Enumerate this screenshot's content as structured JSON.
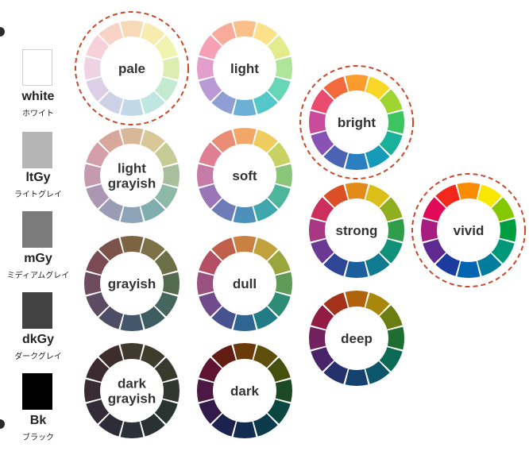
{
  "tones": [
    {
      "id": "pale",
      "label": [
        "pale"
      ],
      "highlighted": true,
      "colors": [
        "#f7d9b5",
        "#f7ebb0",
        "#f1f3b0",
        "#dcedb2",
        "#c4ebd1",
        "#c0e6e3",
        "#c1d8e9",
        "#cdd2e6",
        "#dccfe6",
        "#efd2e4",
        "#f6d1db",
        "#f7d3c8"
      ]
    },
    {
      "id": "light",
      "label": [
        "light"
      ],
      "highlighted": false,
      "colors": [
        "#fbbf8a",
        "#fbe28a",
        "#e2ec8a",
        "#aee59a",
        "#67d6b6",
        "#54c7c8",
        "#6bb0d4",
        "#8f9fd4",
        "#b99ad6",
        "#e39fcb",
        "#f6a0b5",
        "#f8ab98"
      ]
    },
    {
      "id": "bright",
      "label": [
        "bright"
      ],
      "highlighted": true,
      "colors": [
        "#fb9b2d",
        "#f7d626",
        "#9fd432",
        "#3cc460",
        "#1ab19a",
        "#159bba",
        "#2a7fc1",
        "#4b63b5",
        "#8851b4",
        "#c94b9c",
        "#e94a6e",
        "#f26a3c"
      ]
    },
    {
      "id": "vivid",
      "label": [
        "vivid"
      ],
      "highlighted": true,
      "colors": [
        "#fb8c00",
        "#f8e700",
        "#86c800",
        "#009e40",
        "#009878",
        "#007c9c",
        "#0064b0",
        "#1b3c9e",
        "#5e2a90",
        "#a81d80",
        "#e10a58",
        "#f2281c"
      ]
    },
    {
      "id": "ltgy",
      "label": [
        "light",
        "grayish"
      ],
      "highlighted": false,
      "colors": [
        "#d8b898",
        "#d8c898",
        "#c6cc98",
        "#a7bf9c",
        "#8cb9a8",
        "#80aeae",
        "#8da4b8",
        "#9a9cb6",
        "#ab97b4",
        "#c49aaf",
        "#d49fa9",
        "#d8a79c"
      ]
    },
    {
      "id": "soft",
      "label": [
        "soft"
      ],
      "highlighted": false,
      "colors": [
        "#f3a766",
        "#efcc5e",
        "#c8d161",
        "#8bc57a",
        "#4cb59c",
        "#3ea6ad",
        "#4c8fba",
        "#6e7db8",
        "#9a76b6",
        "#c67aa6",
        "#e07e92",
        "#e98d74"
      ]
    },
    {
      "id": "strong",
      "label": [
        "strong"
      ],
      "highlighted": false,
      "colors": [
        "#e28a1a",
        "#dcbe18",
        "#8fae20",
        "#2f9c4a",
        "#12917a",
        "#117a93",
        "#1b5f9c",
        "#2f4596",
        "#6c3992",
        "#a83784",
        "#cc2f5a",
        "#db4e26"
      ]
    },
    {
      "id": "grayish",
      "label": [
        "grayish"
      ],
      "highlighted": false,
      "colors": [
        "#7b6344",
        "#7c7146",
        "#6b7046",
        "#546a4e",
        "#44665c",
        "#3d5e60",
        "#44566a",
        "#4f4d66",
        "#5d4a63",
        "#6f4b5f",
        "#7a4b55",
        "#7c5249"
      ]
    },
    {
      "id": "dull",
      "label": [
        "dull"
      ],
      "highlighted": false,
      "colors": [
        "#c98040",
        "#c1a13c",
        "#99a63e",
        "#5f9a58",
        "#2d8c76",
        "#227c86",
        "#2e6592",
        "#47538e",
        "#704b8c",
        "#995180",
        "#b44f64",
        "#c0604a"
      ]
    },
    {
      "id": "deep",
      "label": [
        "deep"
      ],
      "highlighted": false,
      "colors": [
        "#b0620a",
        "#a8880a",
        "#6c7e12",
        "#1e6e32",
        "#0c6a56",
        "#0b5668",
        "#14416e",
        "#24316a",
        "#482568",
        "#73215e",
        "#921c44",
        "#a4321a"
      ]
    },
    {
      "id": "dkgy",
      "label": [
        "dark",
        "grayish"
      ],
      "highlighted": false,
      "colors": [
        "#40392d",
        "#3f3c2d",
        "#383a2d",
        "#2f372f",
        "#2a3532",
        "#283233",
        "#2b2f37",
        "#2e2c36",
        "#332b35",
        "#382b33",
        "#3b2b30",
        "#3d2e2c"
      ]
    },
    {
      "id": "dark",
      "label": [
        "dark"
      ],
      "highlighted": false,
      "colors": [
        "#6b3a0a",
        "#5e4e0a",
        "#44500e",
        "#1d4a26",
        "#0c4640",
        "#0b3b4a",
        "#112c50",
        "#1c214e",
        "#321a4c",
        "#4c1844",
        "#5e1330",
        "#621d12"
      ]
    }
  ],
  "grays": [
    {
      "name": "white",
      "jp": "ホワイト",
      "color": "#ffffff"
    },
    {
      "name": "ltGy",
      "jp": "ライトグレイ",
      "color": "#b5b5b5"
    },
    {
      "name": "mGy",
      "jp": "ミディアムグレイ",
      "color": "#7b7b7b"
    },
    {
      "name": "dkGy",
      "jp": "ダークグレイ",
      "color": "#424242"
    },
    {
      "name": "Bk",
      "jp": "ブラック",
      "color": "#000000"
    }
  ],
  "colors": {
    "highlight_ring": "#c8492c",
    "label_text": "#333333",
    "swatch_border": "#cfcfcf"
  }
}
